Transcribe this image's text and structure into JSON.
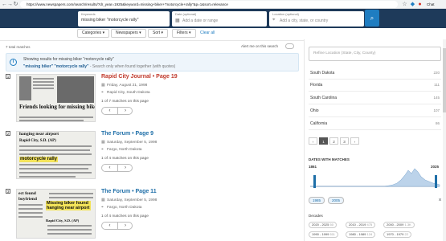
{
  "browser": {
    "url": "https://www.newspapers.com/search/results/?dr_year=1925&keyword=missing+biker+\"motorcycle+rally\"&p=1&sort=relevance",
    "profile_label": "Chat"
  },
  "search": {
    "keywords_label": "Keywords",
    "keywords_value": "missing biker \"motorcycle rally\"",
    "date_label": "Date (optional)",
    "date_placeholder": "Add a date or range",
    "location_label": "Location (optional)",
    "location_placeholder": "Add a city, state, or country"
  },
  "filters": {
    "categories": "Categories ▾",
    "newspapers": "Newspapers ▾",
    "sort": "Sort ▾",
    "filters": "Filters ▾",
    "clear_all": "Clear all"
  },
  "results_header": {
    "count": "7 total matches",
    "alert_label": "Alert me on this search"
  },
  "info": {
    "line1": "Showing results for missing biker \"motorcycle rally\"",
    "line2_query": "\"missing biker\" \"motorcycle rally\"",
    "line2_suffix": " - Search only when found together (with quotes)"
  },
  "results": [
    {
      "num": "1",
      "title": "Rapid City Journal • Page 19",
      "date": "Friday, August 21, 1998",
      "place": "Rapid City, South Dakota",
      "matches": "1 of 7 matches on this page",
      "thumb_headline": "Friends looking for missing biker",
      "thumb_byline": "By Erin Anderson"
    },
    {
      "num": "2",
      "title": "The Forum • Page 9",
      "date": "Saturday, September 5, 1998",
      "place": "Fargo, North Dakota",
      "matches": "1 of 4 matches on this page",
      "thumb_headline": "Rapid City, S.D. (AP)",
      "thumb_highlight": "motorcycle rally"
    },
    {
      "num": "3",
      "title": "The Forum • Page 11",
      "date": "Saturday, September 5, 1998",
      "place": "Fargo, North Dakota",
      "matches": "1 of 4 matches on this page",
      "thumb_headline": "Missing biker found hanging near airport",
      "thumb_byline": "Rapid City, S.D. (AP)"
    }
  ],
  "refine": {
    "placeholder": "Refine Location (State, City, County)",
    "states": [
      {
        "name": "South Dakota",
        "count": "220"
      },
      {
        "name": "Florida",
        "count": "111"
      },
      {
        "name": "South Carolina",
        "count": "145"
      },
      {
        "name": "Ohio",
        "count": "107"
      },
      {
        "name": "California",
        "count": "86"
      }
    ],
    "pages": [
      "‹",
      "1",
      "2",
      "3",
      "›"
    ],
    "current_page": "1"
  },
  "dates": {
    "heading": "DATES WITH MATCHES",
    "start_year": "1861",
    "end_year": "2025",
    "range_start": "1985",
    "range_end": "2005",
    "decades_heading": "Decades",
    "decades": [
      {
        "label": "2020 - 2025",
        "count": "50"
      },
      {
        "label": "2010 - 2019",
        "count": "475"
      },
      {
        "label": "2000 - 2009",
        "count": "1.3K"
      },
      {
        "label": "1990 - 1999",
        "count": "511"
      },
      {
        "label": "1980 - 1989",
        "count": "124"
      },
      {
        "label": "1970 - 1979",
        "count": "22"
      }
    ]
  },
  "colors": {
    "header_bg": "#1e3a5a",
    "accent": "#1f7dc1",
    "title_red": "#c0392b",
    "title_blue": "#1f6fa8",
    "highlight": "#f3e35a"
  }
}
